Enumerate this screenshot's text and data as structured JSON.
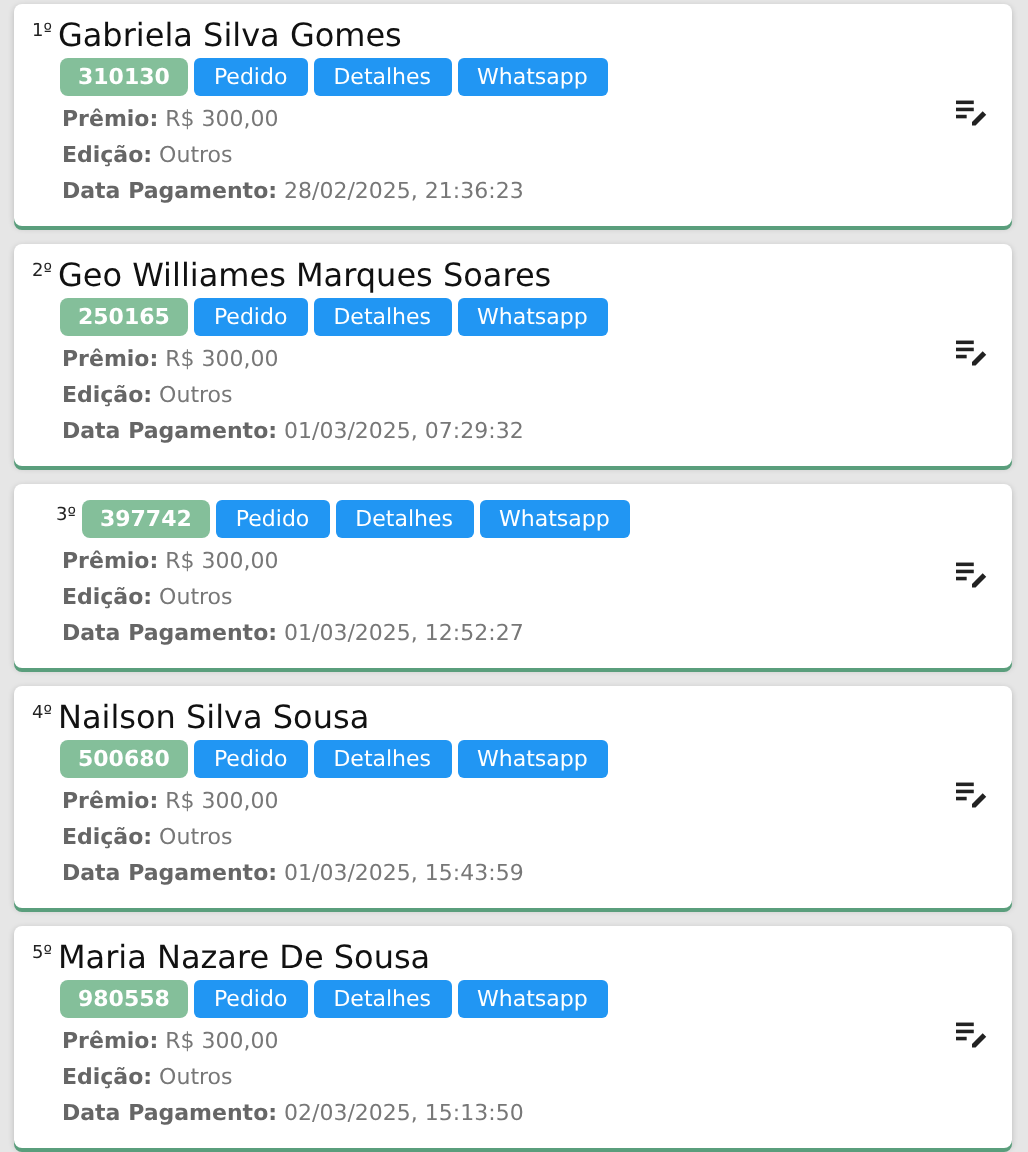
{
  "winners": [
    {
      "rank": "1º",
      "name": "Gabriela Silva Gomes",
      "code": "310130",
      "buttons": [
        "Pedido",
        "Detalhes",
        "Whatsapp"
      ],
      "lines": [
        "**Prêmio:** R$ 300,00",
        "**Edição:** Outros",
        "**Data Pagamento:** 28/02/2025, 21:36:23"
      ]
    },
    {
      "rank": "2º",
      "name": "Geo Williames Marques Soares",
      "code": "250165",
      "buttons": [
        "Pedido",
        "Detalhes",
        "Whatsapp"
      ],
      "lines": [
        "**Prêmio:** R$ 300,00",
        "**Edição:** Outros",
        "**Data Pagamento:** 01/03/2025, 07:29:32"
      ]
    },
    {
      "rank": "3º",
      "code": "397742",
      "buttons": [
        "Pedido",
        "Detalhes",
        "Whatsapp"
      ],
      "lines": [
        "**Prêmio:** R$ 300,00",
        "**Edição:** Outros",
        "**Data Pagamento:** 01/03/2025, 12:52:27"
      ]
    },
    {
      "rank": "4º",
      "name": "Nailson Silva Sousa",
      "code": "500680",
      "buttons": [
        "Pedido",
        "Detalhes",
        "Whatsapp"
      ],
      "lines": [
        "**Prêmio:** R$ 300,00",
        "**Edição:** Outros",
        "**Data Pagamento:** 01/03/2025, 15:43:59"
      ]
    },
    {
      "rank": "5º",
      "name": "Maria Nazare De Sousa",
      "code": "980558",
      "buttons": [
        "Pedido",
        "Detalhes",
        "Whatsapp"
      ],
      "lines": [
        "**Prêmio:** R$ 300,00",
        "**Edição:** Outros",
        "**Data Pagamento:** 02/03/2025, 15:13:50"
      ]
    }
  ]
}
